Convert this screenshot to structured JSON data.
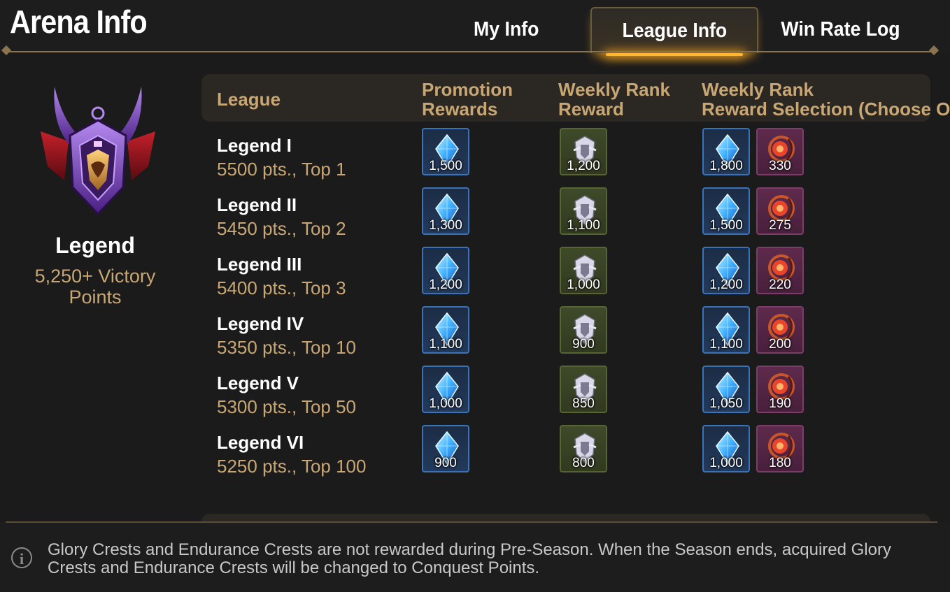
{
  "header": {
    "title": "Arena Info",
    "tabs": [
      {
        "label": "My Info",
        "active": false
      },
      {
        "label": "League Info",
        "active": true
      },
      {
        "label": "Win Rate Log",
        "active": false
      }
    ]
  },
  "tier": {
    "name": "Legend",
    "points": "5,250+ Victory Points"
  },
  "table": {
    "columns": [
      "League",
      "Promotion Rewards",
      "Weekly Rank Reward",
      "Weekly Rank Reward Selection (Choose One)"
    ],
    "col_lines": {
      "league": "League",
      "promo_1": "Promotion",
      "promo_2": "Rewards",
      "weekly_1": "Weekly Rank",
      "weekly_2": "Reward",
      "select_1": "Weekly Rank",
      "select_2": "Reward Selection (Choose One)"
    },
    "rows": [
      {
        "league": "Legend I",
        "requirement": "5500 pts., Top 1",
        "promotion": "1,500",
        "weekly": "1,200",
        "select_gem": "1,800",
        "select_crest": "330"
      },
      {
        "league": "Legend II",
        "requirement": "5450 pts., Top 2",
        "promotion": "1,300",
        "weekly": "1,100",
        "select_gem": "1,500",
        "select_crest": "275"
      },
      {
        "league": "Legend III",
        "requirement": "5400 pts., Top 3",
        "promotion": "1,200",
        "weekly": "1,000",
        "select_gem": "1,200",
        "select_crest": "220"
      },
      {
        "league": "Legend IV",
        "requirement": "5350 pts., Top 10",
        "promotion": "1,100",
        "weekly": "900",
        "select_gem": "1,100",
        "select_crest": "200"
      },
      {
        "league": "Legend V",
        "requirement": "5300 pts., Top 50",
        "promotion": "1,000",
        "weekly": "850",
        "select_gem": "1,050",
        "select_crest": "190"
      },
      {
        "league": "Legend VI",
        "requirement": "5250 pts., Top 100",
        "promotion": "900",
        "weekly": "800",
        "select_gem": "1,000",
        "select_crest": "180"
      }
    ]
  },
  "icons": {
    "promotion": "blue-crystal-icon",
    "weekly": "glory-crest-icon",
    "select_crest": "endurance-crest-icon",
    "info": "info-icon"
  },
  "colors": {
    "accent": "#ffb62e",
    "gold_text": "#c9a774"
  },
  "footer": {
    "note": "Glory Crests and Endurance Crests are not rewarded during Pre-Season. When the Season ends, acquired Glory Crests and Endurance Crests will be changed to Conquest Points."
  }
}
